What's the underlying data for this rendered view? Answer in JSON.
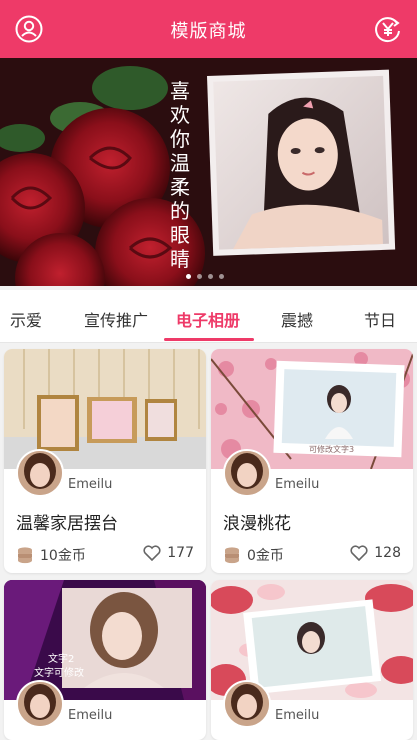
{
  "header": {
    "title": "模版商城",
    "left_icon": "user-icon",
    "right_icon": "yen-exchange-icon",
    "accent": "#ee3a68"
  },
  "banner": {
    "poem": "喜欢你温柔的眼睛",
    "slides": 4,
    "active_slide": 0
  },
  "tabs": [
    {
      "label": "示爱",
      "active": false
    },
    {
      "label": "宣传推广",
      "active": false
    },
    {
      "label": "电子相册",
      "active": true
    },
    {
      "label": "震撼",
      "active": false
    },
    {
      "label": "节日",
      "active": false
    }
  ],
  "cards": [
    {
      "author": "Emeilu",
      "name": "温馨家居摆台",
      "price": "10金币",
      "likes": "177"
    },
    {
      "author": "Emeilu",
      "name": "浪漫桃花",
      "price": "0金币",
      "likes": "128",
      "overlay_text": "可修改文字3"
    },
    {
      "author": "Emeilu",
      "overlay_text_1": "文字2",
      "overlay_text_2": "文字可修改"
    },
    {
      "author": "Emeilu"
    }
  ]
}
